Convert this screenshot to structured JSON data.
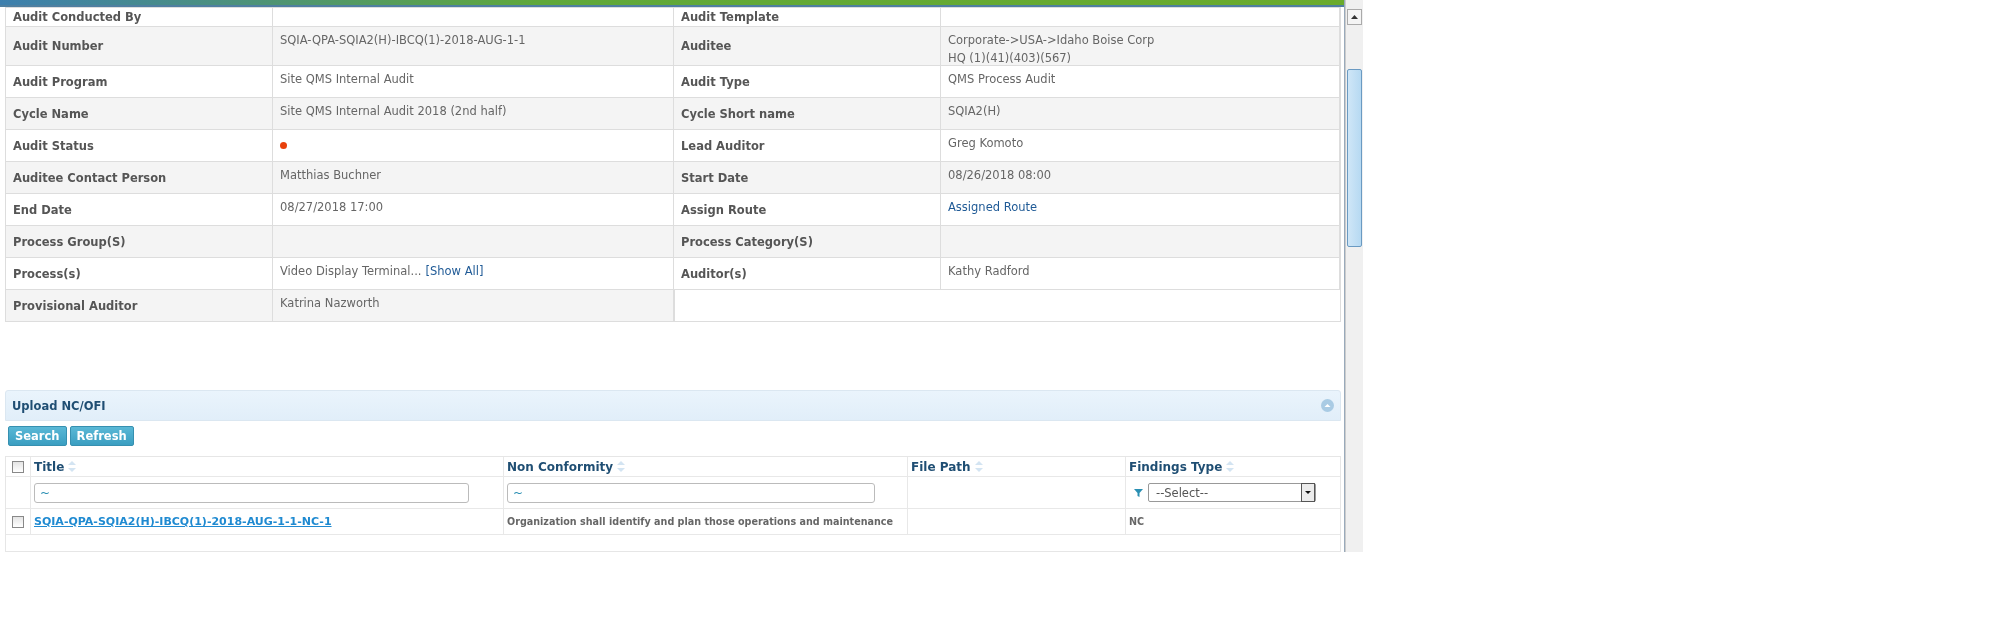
{
  "details": {
    "rows": [
      [
        {
          "label": "Audit Conducted By",
          "kind": "text"
        },
        {
          "label": "Audit Template",
          "kind": "text"
        }
      ],
      [
        {
          "label": "Audit Number",
          "kind": "text",
          "value": "SQIA-QPA-SQIA2(H)-IBCQ(1)-2018-AUG-1-1"
        },
        {
          "label": "Auditee",
          "kind": "lines",
          "lines": [
            "Corporate->USA->Idaho Boise Corp",
            "HQ (1)(41)(403)(567)"
          ]
        }
      ],
      [
        {
          "label": "Audit Program",
          "kind": "text",
          "value": "Site QMS Internal Audit"
        },
        {
          "label": "Audit Type",
          "kind": "text",
          "value": "QMS Process Audit"
        }
      ],
      [
        {
          "label": "Cycle Name",
          "kind": "text",
          "value": "Site QMS Internal Audit 2018 (2nd half)"
        },
        {
          "label": "Cycle Short name",
          "kind": "text",
          "value": "SQIA2(H)"
        }
      ],
      [
        {
          "label": "Audit Status",
          "kind": "status",
          "color": "#e8410c"
        },
        {
          "label": "Lead Auditor",
          "kind": "text",
          "value": "Greg Komoto"
        }
      ],
      [
        {
          "label": "Auditee Contact Person",
          "kind": "text",
          "value": "Matthias Buchner"
        },
        {
          "label": "Start Date",
          "kind": "text",
          "value": "08/26/2018 08:00"
        }
      ],
      [
        {
          "label": "End Date",
          "kind": "text",
          "value": "08/27/2018 17:00"
        },
        {
          "label": "Assign Route",
          "kind": "link",
          "value": "Assigned Route"
        }
      ],
      [
        {
          "label": "Process Group(S)",
          "kind": "text"
        },
        {
          "label": "Process Category(S)",
          "kind": "text"
        }
      ],
      [
        {
          "label": "Process(s)",
          "kind": "text_link",
          "value": "Video Display Terminal...",
          "link": "[Show All]"
        },
        {
          "label": "Auditor(s)",
          "kind": "text",
          "value": "Kathy Radford"
        }
      ],
      [
        {
          "label": "Provisional Auditor",
          "kind": "text",
          "value": "Katrina Nazworth"
        }
      ]
    ]
  },
  "panel": {
    "title": "Upload NC/OFI",
    "buttons": [
      "Search",
      "Refresh"
    ],
    "grid": {
      "header_checked": false,
      "columns": [
        {
          "name": "Title",
          "kind": "input",
          "filter_value": "~"
        },
        {
          "name": "Non Conformity",
          "kind": "input",
          "filter_value": "~"
        },
        {
          "name": "File Path",
          "kind": "none"
        },
        {
          "name": "Findings Type",
          "kind": "select",
          "filter_value": "--Select--"
        }
      ],
      "rows": [
        {
          "checked": false,
          "cells": [
            "SQIA-QPA-SQIA2(H)-IBCQ(1)-2018-AUG-1-1-NC-1",
            "Organization shall identify and plan those operations and maintenance",
            "",
            "NC"
          ]
        }
      ]
    }
  }
}
